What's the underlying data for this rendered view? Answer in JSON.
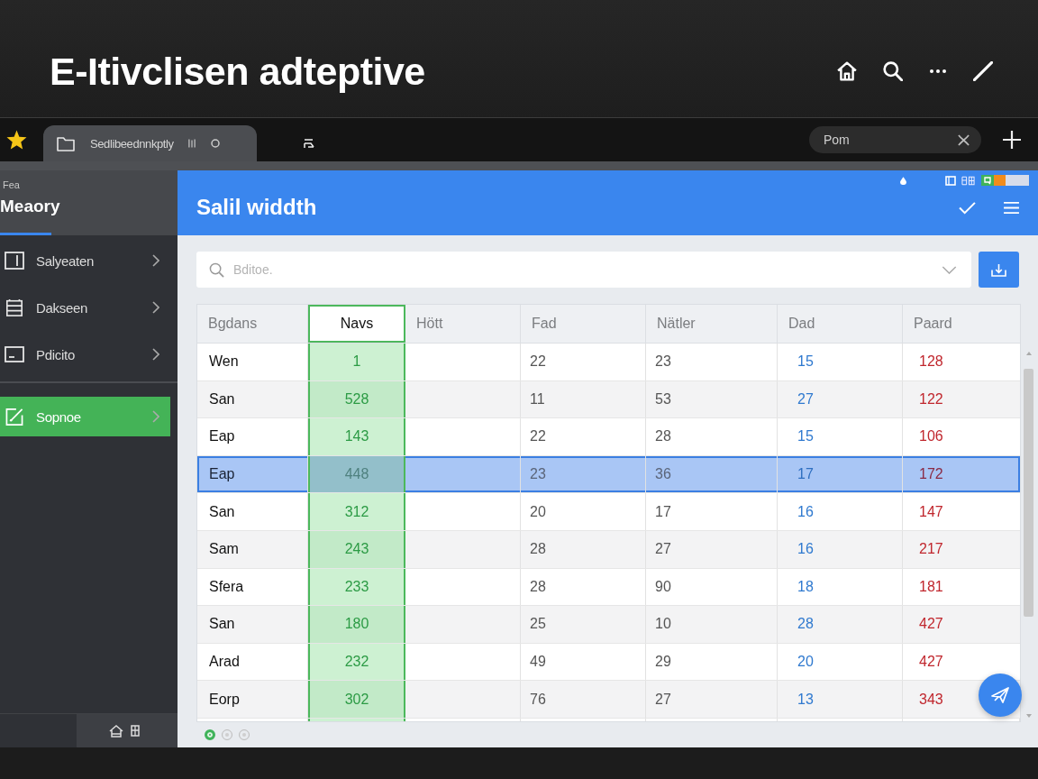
{
  "page": {
    "title": "E-Itivclisen adteptive"
  },
  "tabs": [
    {
      "label": "Sedlibeednnkptly",
      "selected": true
    },
    {
      "selected": false
    }
  ],
  "tab_search": {
    "value": "Pom"
  },
  "sidebar": {
    "caption": "Fea",
    "title": "Meaory",
    "groups": [
      {
        "items": [
          {
            "label": "Salyeaten",
            "selected": false
          },
          {
            "label": "Dakseen",
            "selected": false
          },
          {
            "label": "Pdicito",
            "selected": false
          }
        ]
      },
      {
        "items": [
          {
            "label": "Sopnoe",
            "selected": true
          }
        ]
      }
    ]
  },
  "panel": {
    "title": "Salil widdth",
    "search": {
      "placeholder": "Bditoe."
    }
  },
  "table": {
    "columns": [
      {
        "label": "Bgdans",
        "kind": "name",
        "selected": false
      },
      {
        "label": "Navs",
        "kind": "number",
        "selected": true
      },
      {
        "label": "Hött",
        "kind": "blank",
        "selected": false
      },
      {
        "label": "Fad",
        "kind": "number",
        "selected": false
      },
      {
        "label": "Nätler",
        "kind": "number",
        "selected": false
      },
      {
        "label": "Dad",
        "kind": "info",
        "selected": false
      },
      {
        "label": "Paard",
        "kind": "alert",
        "selected": false
      }
    ],
    "rows": [
      {
        "selected": false,
        "cells": [
          "Wen",
          "1",
          "",
          "22",
          "23",
          "15",
          "128"
        ]
      },
      {
        "selected": false,
        "cells": [
          "San",
          "528",
          "",
          "11",
          "53",
          "27",
          "122"
        ]
      },
      {
        "selected": false,
        "cells": [
          "Eap",
          "143",
          "",
          "22",
          "28",
          "15",
          "106"
        ]
      },
      {
        "selected": true,
        "cells": [
          "Eap",
          "448",
          "",
          "23",
          "36",
          "17",
          "172"
        ]
      },
      {
        "selected": false,
        "cells": [
          "San",
          "312",
          "",
          "20",
          "17",
          "16",
          "147"
        ]
      },
      {
        "selected": false,
        "cells": [
          "Sam",
          "243",
          "",
          "28",
          "27",
          "16",
          "217"
        ]
      },
      {
        "selected": false,
        "cells": [
          "Sfera",
          "233",
          "",
          "28",
          "90",
          "18",
          "181"
        ]
      },
      {
        "selected": false,
        "cells": [
          "San",
          "180",
          "",
          "25",
          "10",
          "28",
          "427"
        ]
      },
      {
        "selected": false,
        "cells": [
          "Arad",
          "232",
          "",
          "49",
          "29",
          "20",
          "427"
        ]
      },
      {
        "selected": false,
        "cells": [
          "Eorp",
          "302",
          "",
          "76",
          "27",
          "13",
          "343"
        ]
      }
    ]
  },
  "pager": [
    {
      "selected": true
    },
    {
      "selected": false
    },
    {
      "selected": false
    }
  ]
}
